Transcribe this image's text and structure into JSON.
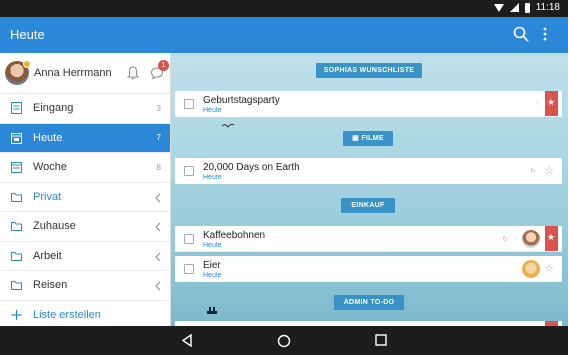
{
  "status_bar": {
    "time": "11:18"
  },
  "app_bar": {
    "title": "Heute"
  },
  "profile": {
    "name": "Anna Herrmann",
    "notification_count": "1"
  },
  "sidebar": {
    "items": [
      {
        "label": "Eingang",
        "count": "3",
        "icon": "inbox-icon"
      },
      {
        "label": "Heute",
        "count": "7",
        "icon": "calendar-icon"
      },
      {
        "label": "Woche",
        "count": "8",
        "icon": "calendar-week-icon"
      },
      {
        "label": "Privat",
        "icon": "folder-icon"
      },
      {
        "label": "Zuhause",
        "icon": "folder-icon"
      },
      {
        "label": "Arbeit",
        "icon": "folder-icon"
      },
      {
        "label": "Reisen",
        "icon": "folder-icon"
      }
    ],
    "create_label": "Liste erstellen"
  },
  "sections": [
    {
      "title": "SOPHIAS WUNSCHLISTE"
    },
    {
      "title": "FILME"
    },
    {
      "title": "EINKAUF"
    },
    {
      "title": "ADMIN TO-DO"
    }
  ],
  "tasks": [
    {
      "title": "Geburtstagsparty",
      "list": "Heute",
      "starred": true
    },
    {
      "title": "20,000 Days on Earth",
      "list": "Heute",
      "starred": false
    },
    {
      "title": "Kaffeebohnen",
      "list": "Heute",
      "starred": true
    },
    {
      "title": "Eier",
      "list": "Heute",
      "starred": false
    }
  ],
  "colors": {
    "accent": "#2b88d8",
    "section_header": "#3a93c8",
    "star_ribbon": "#d9534f"
  }
}
